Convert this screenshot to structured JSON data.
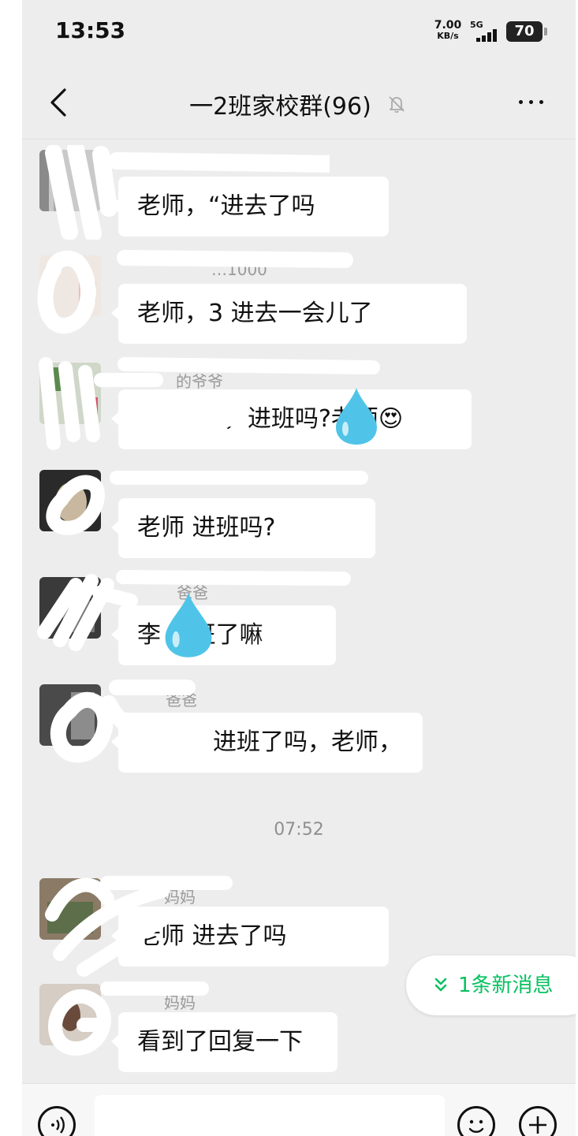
{
  "status_bar": {
    "time": "13:53",
    "net_speed_value": "7.00",
    "net_speed_unit": "KB/s",
    "network": "5G",
    "battery": "70"
  },
  "header": {
    "title": "一2班家校群(96)",
    "back_icon": "chevron-left-icon",
    "mute_icon": "bell-off-icon",
    "more_icon": "more-dots-icon"
  },
  "messages": [
    {
      "sender": "",
      "text": "老师，“进去了吗"
    },
    {
      "sender": "…1000",
      "text": "老师，3 进去一会儿了"
    },
    {
      "sender": "的爷爷",
      "text": "，进班吗?老师😍"
    },
    {
      "sender": "",
      "text": "老师 进班吗?"
    },
    {
      "sender": "爸爸",
      "text": "李 进班了嘛"
    },
    {
      "sender": "爸爸",
      "text": "进班了吗，老师，"
    },
    {
      "sender": "妈妈",
      "text": "老师 进去了吗"
    },
    {
      "sender": "妈妈",
      "text": "看到了回复一下"
    }
  ],
  "timestamp": "07:52",
  "new_messages_label": "1条新消息",
  "colors": {
    "chat_background": "#ededed",
    "bubble": "#ffffff",
    "accent_green": "#07c160",
    "drop_blue": "#4fc4e8"
  }
}
